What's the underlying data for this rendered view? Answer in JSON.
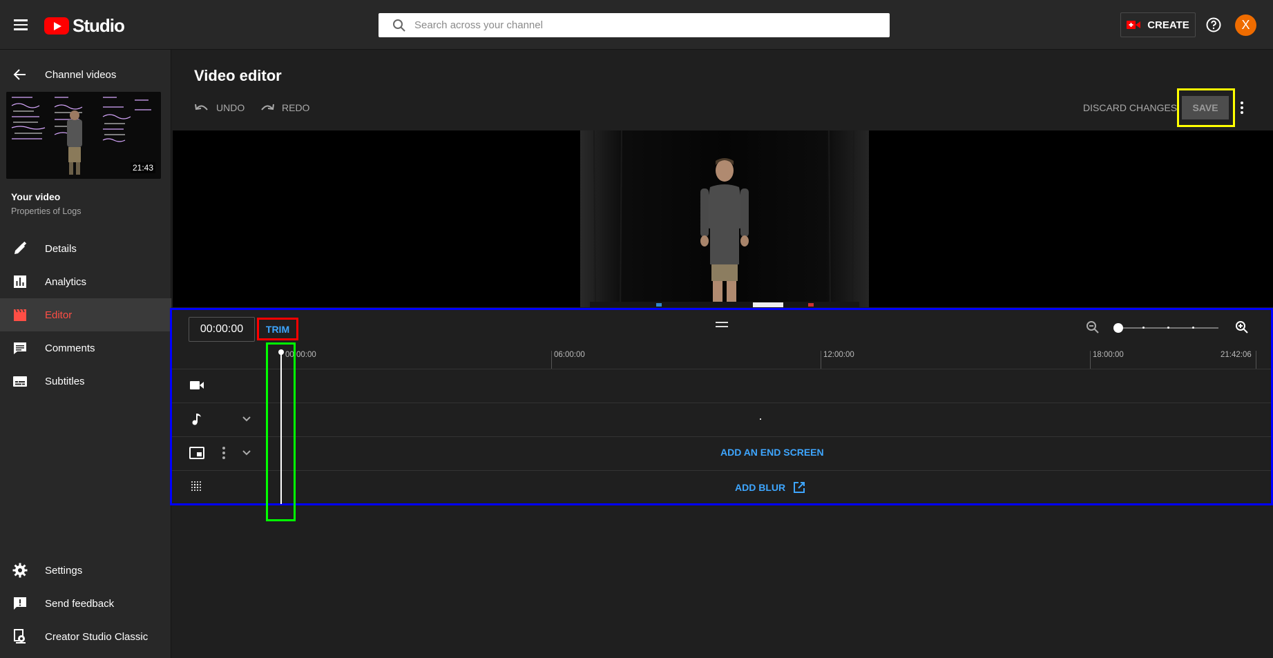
{
  "header": {
    "logo_text": "Studio",
    "search_placeholder": "Search across your channel",
    "create_label": "CREATE",
    "avatar_letter": "X"
  },
  "sidebar": {
    "back_label": "Channel videos",
    "thumbnail_duration": "21:43",
    "your_video_label": "Your video",
    "video_title": "Properties of Logs",
    "items": [
      {
        "label": "Details",
        "icon": "pencil-icon",
        "active": false
      },
      {
        "label": "Analytics",
        "icon": "bar-chart-icon",
        "active": false
      },
      {
        "label": "Editor",
        "icon": "clapperboard-icon",
        "active": true
      },
      {
        "label": "Comments",
        "icon": "comment-icon",
        "active": false
      },
      {
        "label": "Subtitles",
        "icon": "subtitles-icon",
        "active": false
      }
    ],
    "bottom_items": [
      {
        "label": "Settings",
        "icon": "gear-icon"
      },
      {
        "label": "Send feedback",
        "icon": "feedback-icon"
      },
      {
        "label": "Creator Studio Classic",
        "icon": "classic-studio-icon"
      }
    ]
  },
  "editor": {
    "title": "Video editor",
    "undo_label": "UNDO",
    "redo_label": "REDO",
    "discard_label": "DISCARD CHANGES",
    "save_label": "SAVE"
  },
  "timeline": {
    "timecode": "00:00:00",
    "trim_label": "TRIM",
    "ruler": [
      "00:00:00",
      "06:00:00",
      "12:00:00",
      "18:00:00",
      "21:42:06"
    ],
    "add_end_screen_label": "ADD AN END SCREEN",
    "add_blur_label": "ADD BLUR"
  },
  "colors": {
    "accent_blue": "#3ea6ff",
    "active_red": "#ff4e45",
    "brand_red": "#ff0000",
    "avatar_orange": "#ef6c00"
  }
}
